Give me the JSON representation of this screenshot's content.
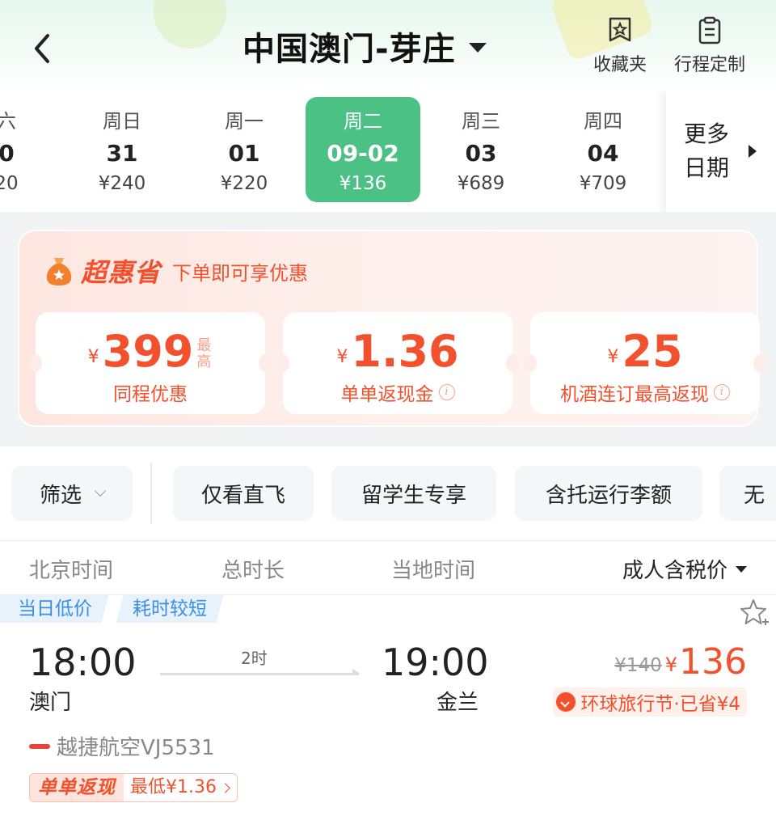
{
  "header": {
    "title": "中国澳门-芽庄",
    "favorites_label": "收藏夹",
    "itinerary_label": "行程定制"
  },
  "dates": [
    {
      "weekday": "六",
      "date": "0",
      "price": "20"
    },
    {
      "weekday": "周日",
      "date": "31",
      "price": "¥240"
    },
    {
      "weekday": "周一",
      "date": "01",
      "price": "¥220"
    },
    {
      "weekday": "周二",
      "date": "09-02",
      "price": "¥136",
      "selected": true
    },
    {
      "weekday": "周三",
      "date": "03",
      "price": "¥689"
    },
    {
      "weekday": "周四",
      "date": "04",
      "price": "¥709"
    }
  ],
  "more_dates": "更多日期",
  "promo": {
    "brand": "超惠省",
    "subtitle": "下单即可享优惠",
    "coupons": [
      {
        "currency": "¥",
        "amount": "399",
        "suffix": "最高",
        "label": "同程优惠"
      },
      {
        "currency": "¥",
        "amount": "1.36",
        "suffix": "",
        "label": "单单返现金"
      },
      {
        "currency": "¥",
        "amount": "25",
        "suffix": "",
        "label": "机酒连订最高返现"
      }
    ]
  },
  "filters": {
    "filter_label": "筛选",
    "chips": [
      "仅看直飞",
      "留学生专享",
      "含托运行李额",
      "无"
    ]
  },
  "columns": {
    "beijing_time": "北京时间",
    "duration": "总时长",
    "local_time": "当地时间",
    "sort_label": "成人含税价"
  },
  "flight": {
    "tags": [
      "当日低价",
      "耗时较短"
    ],
    "dep_time": "18:00",
    "dep_city": "澳门",
    "duration": "2时",
    "arr_time": "19:00",
    "arr_city": "金兰",
    "old_price": "¥140",
    "currency": "¥",
    "price": "136",
    "deal": "环球旅行节·已省¥4",
    "airline": "越捷航空VJ5531",
    "cashback_badge": "单单返现",
    "cashback_text": "最低¥1.36"
  },
  "colors": {
    "accent_green": "#4cc185",
    "accent_orange": "#f3502d",
    "tag_blue": "#3a8ee6"
  }
}
